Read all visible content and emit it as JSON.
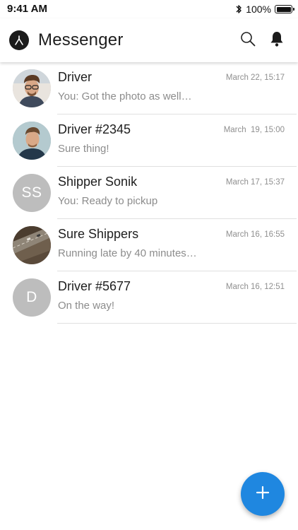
{
  "status_bar": {
    "time": "9:41 AM",
    "battery_text": "100%",
    "battery_level": 1.0,
    "icons": [
      "bluetooth-icon",
      "battery-icon"
    ]
  },
  "header": {
    "title": "Messenger",
    "icons": [
      "app-logo-icon",
      "search-icon",
      "bell-icon"
    ]
  },
  "conversations": [
    {
      "name": "Driver",
      "preview": "You: Got the photo as well…",
      "timestamp": "March 22, 15:17",
      "avatar": {
        "type": "photo",
        "description_icon": "avatar-photo"
      }
    },
    {
      "name": "Driver #2345",
      "preview": "Sure thing!",
      "timestamp": "March  19, 15:00",
      "avatar": {
        "type": "photo",
        "description_icon": "avatar-photo"
      }
    },
    {
      "name": "Shipper Sonik",
      "preview": "You:  Ready to pickup",
      "timestamp": "March 17, 15:37",
      "avatar": {
        "type": "initials",
        "initials": "SS"
      }
    },
    {
      "name": "Sure Shippers",
      "preview": "Running late by 40 minutes…",
      "timestamp": "March 16, 16:55",
      "avatar": {
        "type": "photo",
        "description_icon": "avatar-photo"
      }
    },
    {
      "name": "Driver #5677",
      "preview": "On the way!",
      "timestamp": "March 16, 12:51",
      "avatar": {
        "type": "initials",
        "initials": "D"
      }
    }
  ],
  "fab": {
    "icon": "plus-icon"
  },
  "colors": {
    "accent": "#1f87e0",
    "initials_avatar_bg": "#bdbdbd",
    "preview_text": "#8c8c8c",
    "divider": "#e0e0e0"
  }
}
